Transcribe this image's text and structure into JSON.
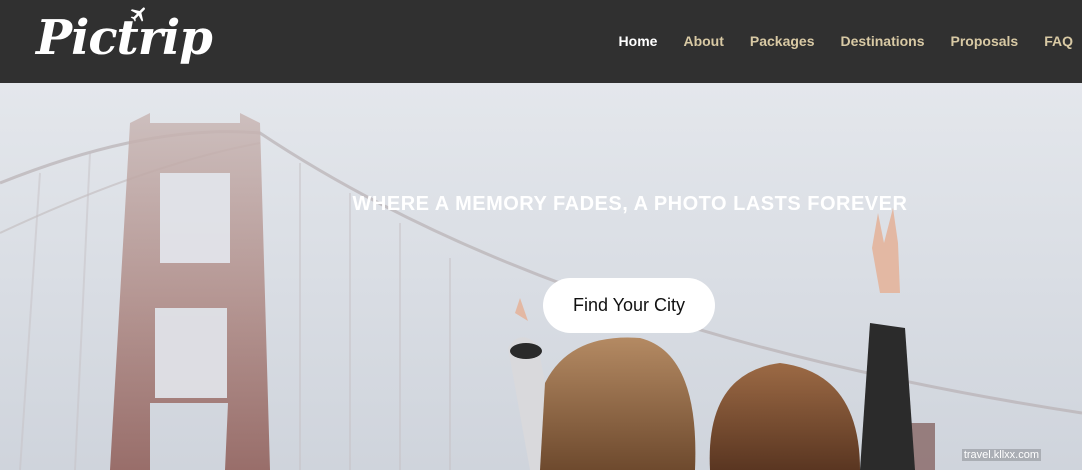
{
  "brand": {
    "logo_text": "Pictrip",
    "logo_icon": "airplane-icon"
  },
  "nav": {
    "items": [
      {
        "label": "Home",
        "active": true
      },
      {
        "label": "About",
        "active": false
      },
      {
        "label": "Packages",
        "active": false
      },
      {
        "label": "Destinations",
        "active": false
      },
      {
        "label": "Proposals",
        "active": false
      },
      {
        "label": "FAQ",
        "active": false
      }
    ]
  },
  "hero": {
    "tagline": "WHERE A MEMORY FADES, A PHOTO LASTS FOREVER",
    "cta_label": "Find Your City",
    "background": "two women making peace signs in front of the Golden Gate Bridge on a foggy day"
  },
  "watermark": "travel.kllxx.com",
  "colors": {
    "header_bg": "#303030",
    "nav_text": "#d8c9a4",
    "nav_active": "#ffffff",
    "cta_bg": "#ffffff"
  }
}
